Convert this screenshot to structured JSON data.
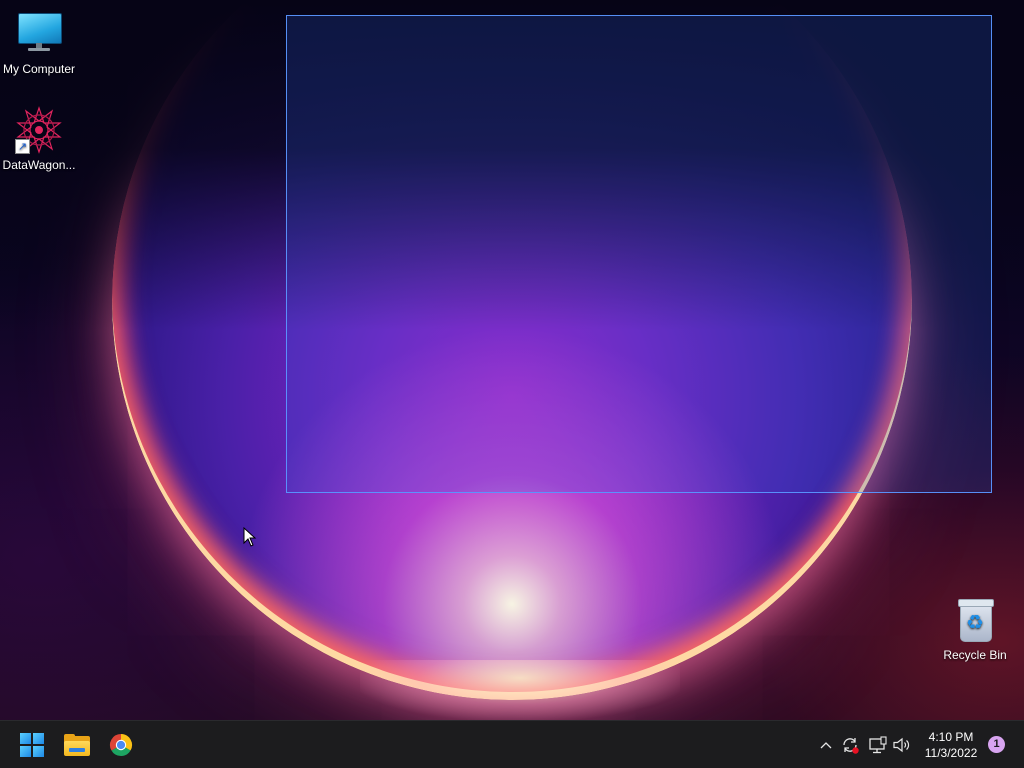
{
  "desktop": {
    "icons": [
      {
        "label": "My Computer",
        "icon": "monitor-icon"
      },
      {
        "label": "DataWagon...",
        "icon": "datawagon-star-icon",
        "shortcut": true
      },
      {
        "label": "Recycle Bin",
        "icon": "recycle-bin-icon"
      }
    ]
  },
  "taskbar": {
    "apps": [
      {
        "name": "Start",
        "icon": "windows-logo-icon"
      },
      {
        "name": "File Explorer",
        "icon": "folder-icon"
      },
      {
        "name": "Google Chrome",
        "icon": "chrome-icon"
      }
    ],
    "tray": {
      "icons": [
        "chevron-up-icon",
        "sync-icon",
        "network-icon",
        "volume-icon"
      ],
      "clock_time": "4:10 PM",
      "clock_date": "11/3/2022",
      "notification_count": "1"
    }
  },
  "colors": {
    "taskbar_bg": "#1c1c1e",
    "selection_border": "#5a96ff",
    "accent_blue": "#1e88e5",
    "notification_badge": "#d8a4f0"
  }
}
